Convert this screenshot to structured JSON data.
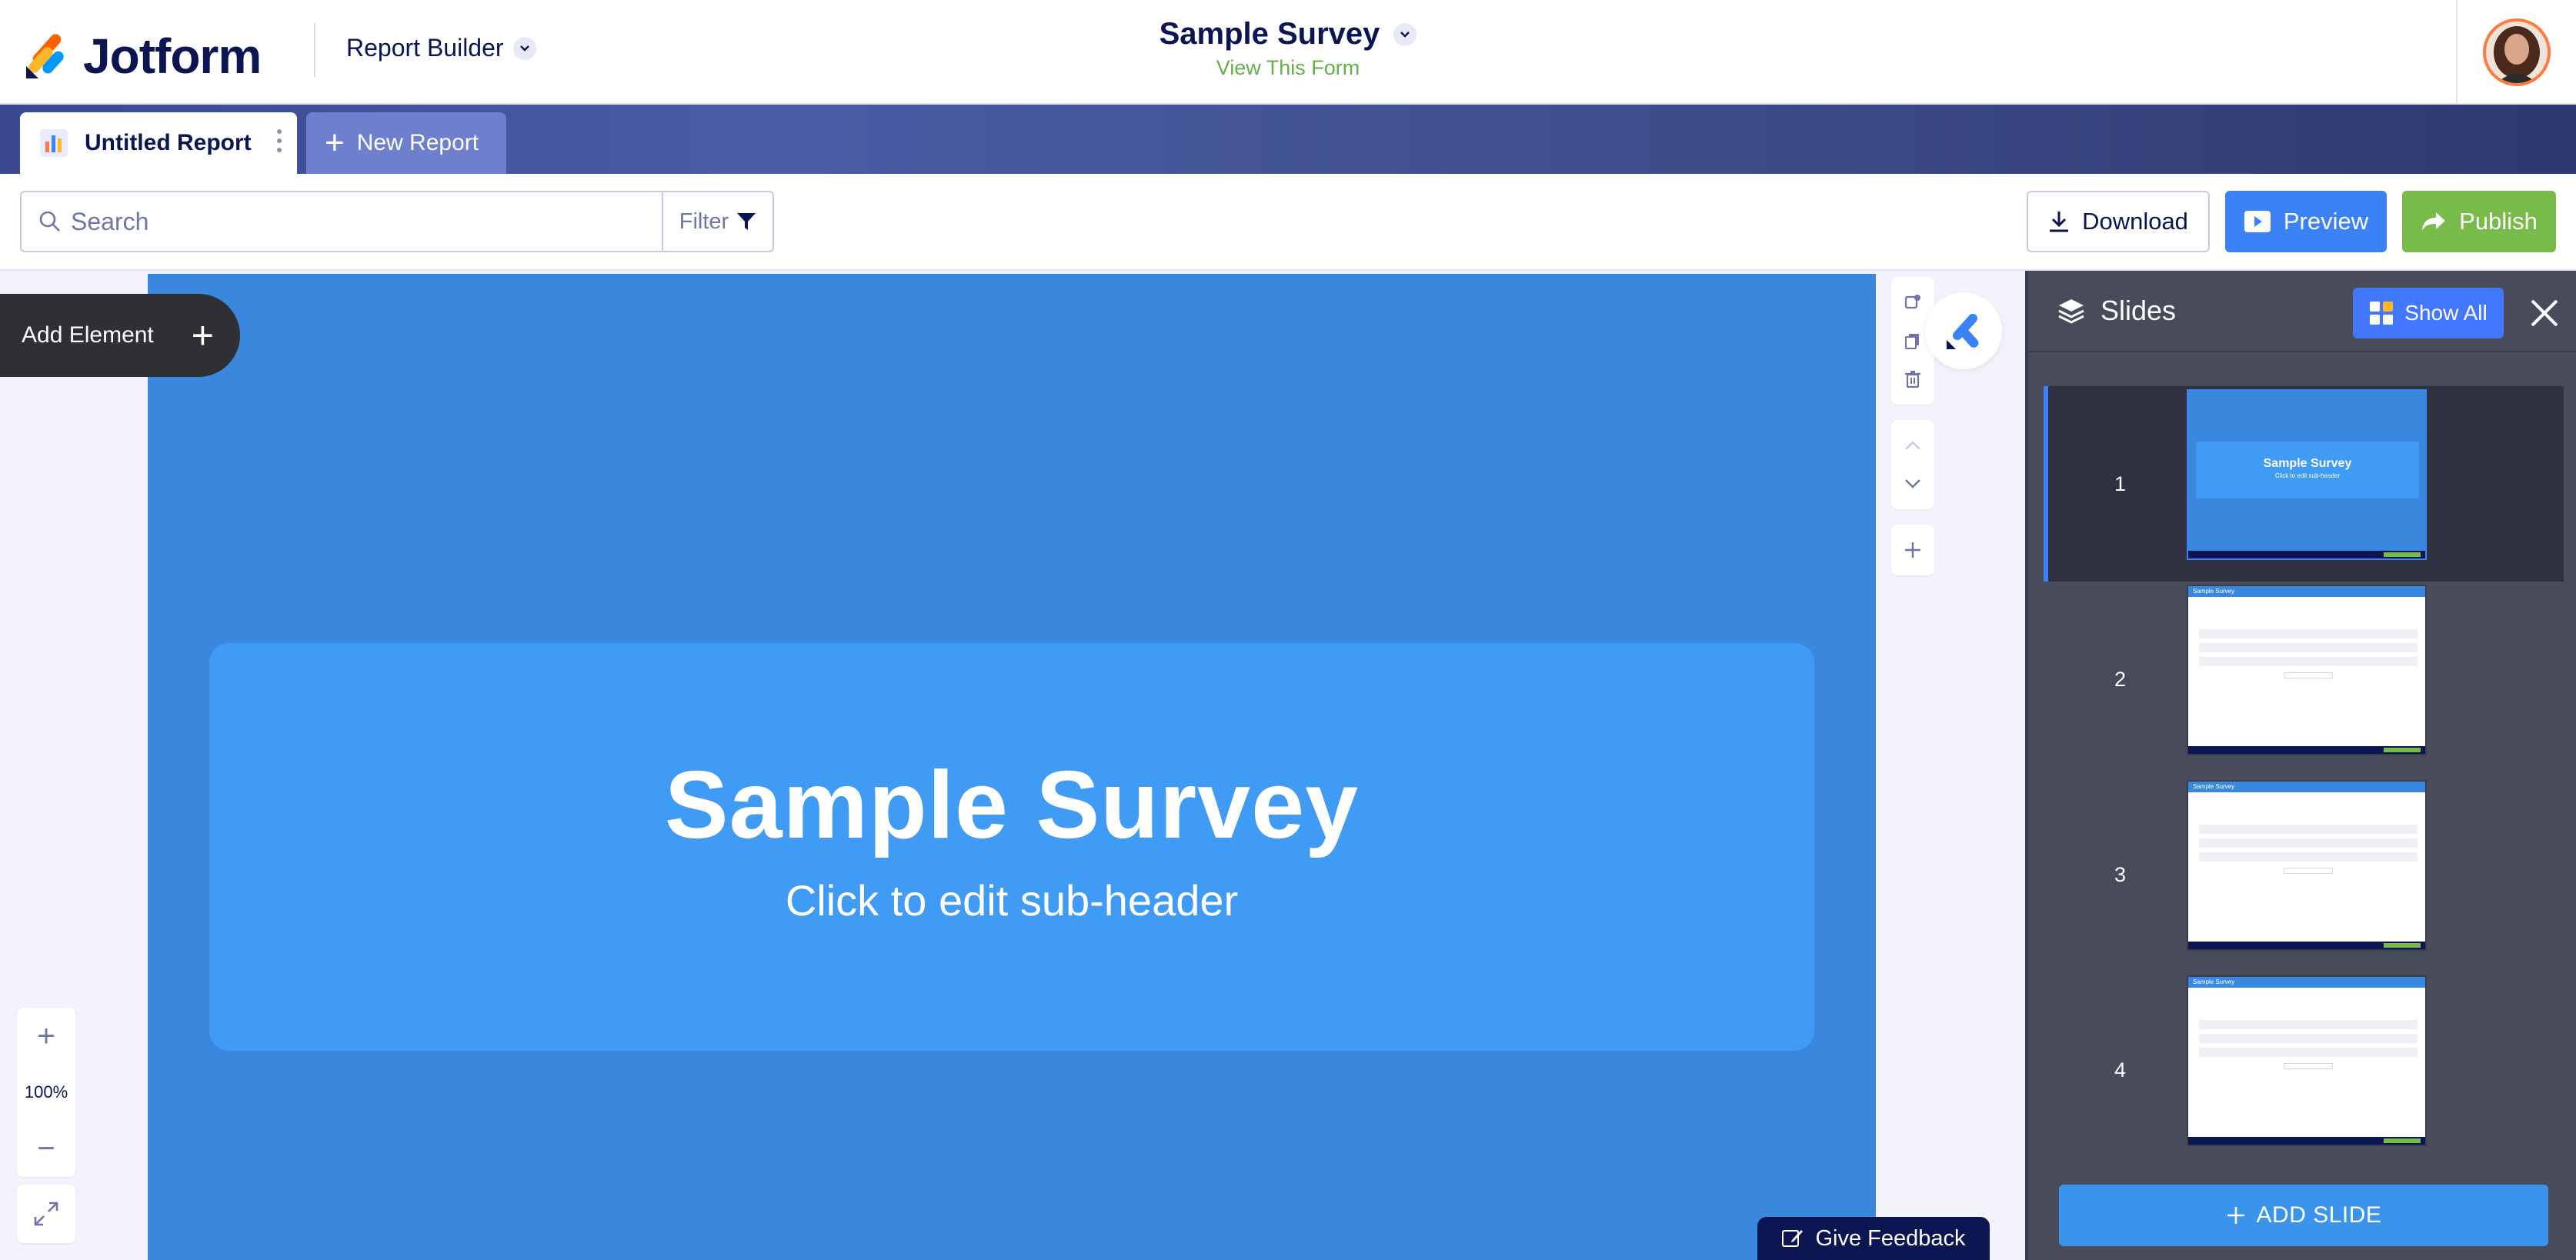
{
  "brand": {
    "name": "Jotform"
  },
  "app_switcher": {
    "label": "Report Builder"
  },
  "form": {
    "title": "Sample Survey",
    "view_link": "View This Form"
  },
  "tabs": {
    "active_label": "Untitled Report",
    "new_label": "New Report"
  },
  "toolbar": {
    "search_placeholder": "Search",
    "filter_label": "Filter",
    "download_label": "Download",
    "preview_label": "Preview",
    "publish_label": "Publish"
  },
  "canvas": {
    "add_element_label": "Add Element",
    "slide_title": "Sample Survey",
    "slide_subheader": "Click to edit sub-header",
    "zoom_level": "100%",
    "feedback_label": "Give Feedback"
  },
  "slides_panel": {
    "title": "Slides",
    "show_all_label": "Show All",
    "add_slide_label": "ADD SLIDE",
    "slides": [
      {
        "number": "1",
        "thumb_title": "Sample Survey",
        "thumb_sub": "Click to edit sub-header"
      },
      {
        "number": "2",
        "thumb_header": "Sample Survey"
      },
      {
        "number": "3",
        "thumb_header": "Sample Survey"
      },
      {
        "number": "4",
        "thumb_header": "Sample Survey"
      }
    ]
  },
  "colors": {
    "brand_navy": "#0a1551",
    "slide_bg": "#3a88de",
    "slide_box": "#409bf4",
    "preview_blue": "#3b82f6",
    "publish_green": "#78bb4a",
    "view_link_green": "#64b245",
    "panel_bg": "#484b5a"
  }
}
